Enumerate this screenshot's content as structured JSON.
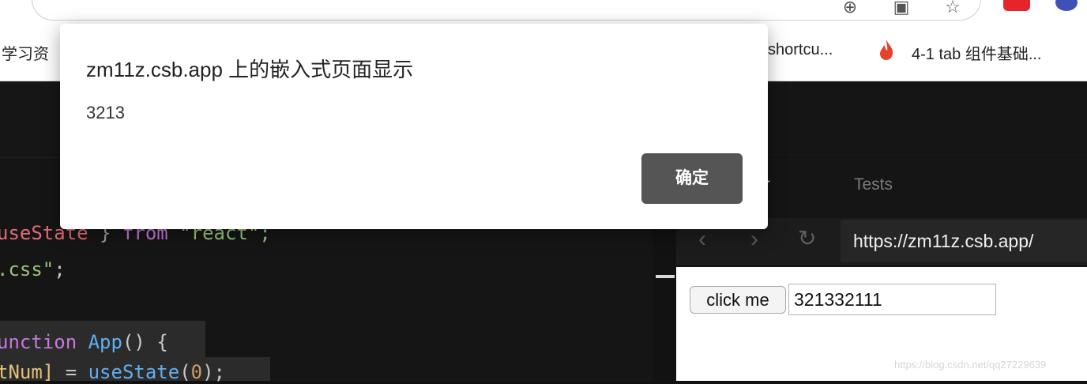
{
  "bookmarks": {
    "left_label": "学习资",
    "mid_label": "shortcu...",
    "right_label": "4-1 tab 组件基础..."
  },
  "editor": {
    "lines": [
      {
        "parts": [
          {
            "t": "useState",
            "c": "#e06c75"
          },
          {
            "t": " } ",
            "c": "#9aa0a6"
          },
          {
            "t": "from",
            "c": "#c678dd"
          },
          {
            "t": " \"react\";",
            "c": "#98c379"
          }
        ]
      },
      {
        "parts": [
          {
            "t": ".css\"",
            "c": "#98c379"
          },
          {
            "t": ";",
            "c": "#c8c8c8"
          }
        ]
      },
      {
        "parts": []
      },
      {
        "parts": [
          {
            "t": "unction",
            "c": "#c678dd"
          },
          {
            "t": " ",
            "c": "#c8c8c8"
          },
          {
            "t": "App",
            "c": "#61afef"
          },
          {
            "t": "() {",
            "c": "#c8c8c8"
          }
        ]
      },
      {
        "parts": [
          {
            "t": "tNum]",
            "c": "#e5c07b"
          },
          {
            "t": " = ",
            "c": "#c8c8c8"
          },
          {
            "t": "useState",
            "c": "#61afef"
          },
          {
            "t": "(",
            "c": "#c8c8c8"
          },
          {
            "t": "0",
            "c": "#d19a66"
          },
          {
            "t": ");",
            "c": "#c8c8c8"
          }
        ]
      }
    ]
  },
  "preview": {
    "tab_partial": "er",
    "tab_tests": "Tests",
    "url": "https://zm11z.csb.app/",
    "button_label": "click me",
    "input_value": "321332111",
    "watermark": "https://blog.csdn.net/qq27229639"
  },
  "dialog": {
    "title": "zm11z.csb.app 上的嵌入式页面显示",
    "message": "3213",
    "ok_label": "确定"
  },
  "colors": {
    "dialog_button": "#555555",
    "editor_bg": "#151515",
    "string_green": "#98c379",
    "keyword_purple": "#c678dd",
    "function_blue": "#61afef"
  }
}
